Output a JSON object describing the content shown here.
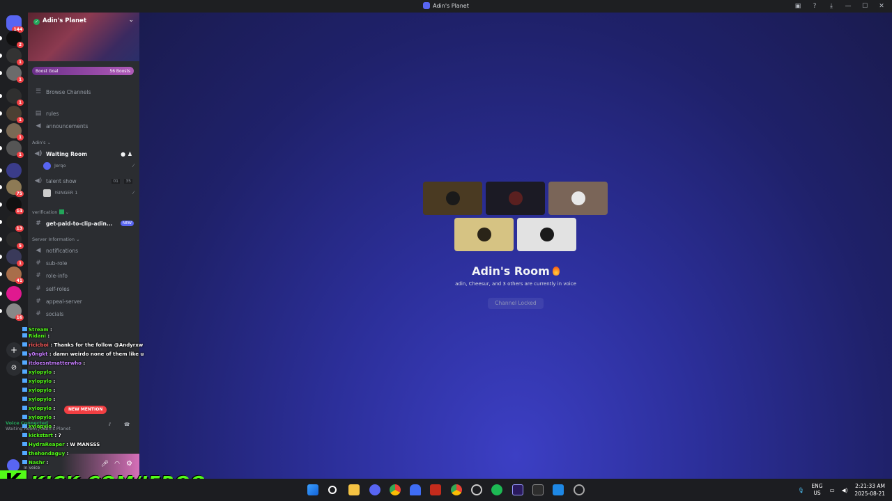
{
  "window": {
    "title": "Adin's Planet",
    "controls": [
      "inbox-icon",
      "help-icon",
      "download-icon",
      "minimize-icon",
      "maximize-icon",
      "close-icon"
    ]
  },
  "rail": {
    "home_badge": "144",
    "servers": [
      {
        "badge": "2"
      },
      {
        "badge": "1"
      },
      {
        "badge": "1"
      },
      {
        "badge": "1"
      },
      {
        "badge": "1"
      },
      {
        "badge": "1"
      },
      {
        "badge": "1"
      },
      {
        "badge": ""
      },
      {
        "badge": "75"
      },
      {
        "badge": "14"
      },
      {
        "badge": "13"
      },
      {
        "badge": "5"
      },
      {
        "badge": "1"
      },
      {
        "badge": "41"
      },
      {
        "badge": ""
      },
      {
        "badge": "16"
      }
    ]
  },
  "server": {
    "name": "Adin's Planet",
    "boost_label": "Boost Goal",
    "boost_count": "56 Boosts",
    "browse": "Browse Channels"
  },
  "channels": {
    "rules": "rules",
    "announcements": "announcements",
    "cat_adins": "Adin's",
    "waiting_room": "Waiting Room",
    "waiting_user": "Jerqo",
    "talent_show": "talent show",
    "talent_count_a": "01",
    "talent_count_b": "35",
    "talent_user": "!SINGER 1",
    "cat_verification": "verification",
    "get_paid": "get-paid-to-clip-adin...",
    "new_tag": "NEW",
    "cat_server_info": "Server Information",
    "notifications": "notifications",
    "sub_role": "sub-role",
    "role_info": "role-info",
    "self_roles": "self-roles",
    "appeal_server": "appeal-server",
    "socials": "socials"
  },
  "chat": [
    {
      "user": "Stream",
      "text": ""
    },
    {
      "user": "Ridani",
      "text": ""
    },
    {
      "user": "ricicboi",
      "text": "Thanks for the follow @Andyrxw"
    },
    {
      "user": "y0ngkt",
      "text": "damn weirdo none of them like u"
    },
    {
      "user": "itdoesntmatterwho",
      "text": ""
    },
    {
      "user": "xylopylo",
      "text": ""
    },
    {
      "user": "xylopylo",
      "text": ""
    },
    {
      "user": "xylopylo",
      "text": ""
    },
    {
      "user": "xylopylo",
      "text": ""
    },
    {
      "user": "xylopylo",
      "text": ""
    },
    {
      "user": "xylopylo",
      "text": ""
    },
    {
      "user": "xylopylo",
      "text": ""
    },
    {
      "user": "kickstart",
      "text": "?"
    },
    {
      "user": "HydraReaper",
      "text": "W MANSSS"
    },
    {
      "user": "thehondaguy",
      "text": ""
    },
    {
      "user": "Nashr",
      "text": ""
    }
  ],
  "mention": "NEW MENTION",
  "voice": {
    "status": "Voice Connected",
    "location": "Waiting Room / Adin's Planet",
    "state": "In voice"
  },
  "kick": {
    "letter": "K",
    "url": "KICK.COM/JERQO"
  },
  "stage": {
    "title": "Adin's Room",
    "subtitle": "adin, Cheesur, and 3 others are currently in voice",
    "locked": "Channel Locked",
    "tiles": [
      {
        "bg": "#4a3a22",
        "face": "#1a1a1a"
      },
      {
        "bg": "#1b1a24",
        "face": "#5a2020"
      },
      {
        "bg": "#7a6558",
        "face": "#e8e8e8"
      },
      {
        "bg": "#d6c383",
        "face": "#2a2418"
      },
      {
        "bg": "#e2e2e2",
        "face": "#1a1a1a"
      }
    ]
  },
  "taskbar": {
    "lang_top": "ENG",
    "lang_bottom": "US",
    "time": "2:21:33 AM",
    "date": "2025-08-21"
  }
}
